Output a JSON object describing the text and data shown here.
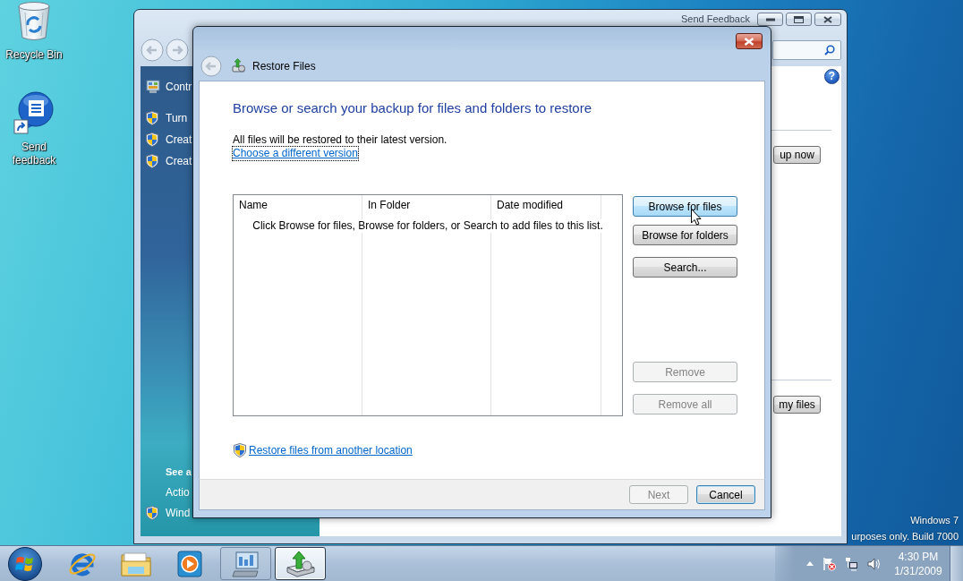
{
  "desktop": {
    "icons": [
      {
        "kind": "bin",
        "label": "Recycle Bin"
      },
      {
        "kind": "feedback",
        "label": "Send feedback"
      }
    ],
    "branding": [
      "Windows 7",
      "urposes only. Build 7000"
    ]
  },
  "background_window": {
    "feedback_link": "Send Feedback",
    "sidebar": {
      "items": [
        {
          "kind": "home",
          "label": "Contr"
        },
        {
          "kind": "shield",
          "label": "Turn"
        },
        {
          "kind": "shield",
          "label": "Creat"
        },
        {
          "kind": "shield",
          "label": "Creat"
        }
      ],
      "see_also": {
        "heading": "See a",
        "items": [
          {
            "kind": "plain",
            "label": "Actio"
          },
          {
            "kind": "shield",
            "label": "Wind"
          }
        ]
      }
    },
    "help": "?",
    "buttons": [
      "up now",
      "my files"
    ]
  },
  "dialog": {
    "title": "Restore Files",
    "heading": "Browse or search your backup for files and folders to restore",
    "info": "All files will be restored to their latest version.",
    "version_link": {
      "label": "Choose a different version",
      "focused": true
    },
    "file_list": {
      "columns": [
        "Name",
        "In Folder",
        "Date modified"
      ],
      "empty_message": "Click Browse for files, Browse for folders, or Search to add files to this list."
    },
    "browse_buttons": [
      {
        "label": "Browse for files",
        "hovered": true,
        "disabled": false
      },
      {
        "label": "Browse for folders",
        "hovered": false,
        "disabled": false
      },
      {
        "label": "Search...",
        "hovered": false,
        "disabled": false
      }
    ],
    "remove_buttons": [
      {
        "label": "Remove",
        "disabled": true
      },
      {
        "label": "Remove all",
        "disabled": true
      }
    ],
    "location_link": "Restore files from another location",
    "footer_buttons": [
      {
        "label": "Next",
        "disabled": true,
        "default": false
      },
      {
        "label": "Cancel",
        "disabled": false,
        "default": true
      }
    ]
  },
  "taskbar": {
    "apps": [
      {
        "kind": "browser",
        "running": false,
        "selected": false
      },
      {
        "kind": "folder",
        "running": false,
        "selected": false
      },
      {
        "kind": "media",
        "running": false,
        "selected": false
      },
      {
        "kind": "control-panel",
        "running": true,
        "selected": false
      },
      {
        "kind": "backup",
        "running": true,
        "selected": true
      }
    ],
    "clock": {
      "time": "4:30 PM",
      "date": "1/31/2009"
    }
  }
}
